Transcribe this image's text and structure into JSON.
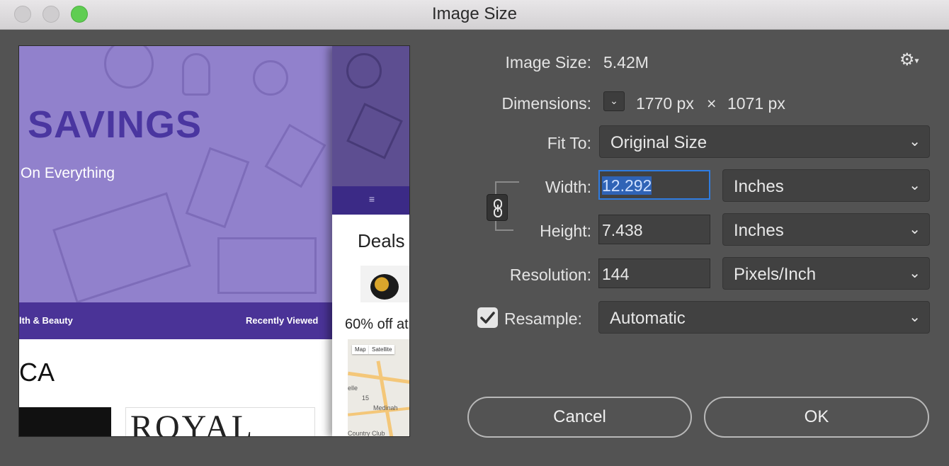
{
  "window": {
    "title": "Image Size"
  },
  "preview": {
    "headline": "SAVINGS",
    "subline": "On Everything",
    "nav_left": "lth & Beauty",
    "nav_right": "Recently Viewed",
    "section_heading": "CA",
    "logo_text": "ROYAL GRILL",
    "mobile_menu": "≡",
    "mobile_deals": "Deals",
    "mobile_offer": "60% off at",
    "map_tab_map": "Map",
    "map_tab_satellite": "Satellite",
    "map_label_1": "Medinah",
    "map_label_2": "Country Club",
    "map_label_3": "elle",
    "map_label_4": "15"
  },
  "info": {
    "image_size_label": "Image Size:",
    "image_size_value": "5.42M",
    "dimensions_label": "Dimensions:",
    "dimensions_width": "1770 px",
    "dimensions_times": "×",
    "dimensions_height": "1071 px"
  },
  "fit_to": {
    "label": "Fit To:",
    "value": "Original Size"
  },
  "width": {
    "label": "Width:",
    "value": "12.292",
    "unit": "Inches"
  },
  "height": {
    "label": "Height:",
    "value": "7.438",
    "unit": "Inches"
  },
  "resolution": {
    "label": "Resolution:",
    "value": "144",
    "unit": "Pixels/Inch"
  },
  "resample": {
    "label": "Resample:",
    "value": "Automatic",
    "checked": true
  },
  "buttons": {
    "cancel": "Cancel",
    "ok": "OK"
  },
  "icons": {
    "gear": "gear-icon",
    "link": "link-icon",
    "check": "checkmark-icon",
    "chevron": "chevron-down-icon"
  },
  "colors": {
    "accent": "#2f7ce0",
    "selection": "#2f63b6",
    "background": "#535353"
  }
}
